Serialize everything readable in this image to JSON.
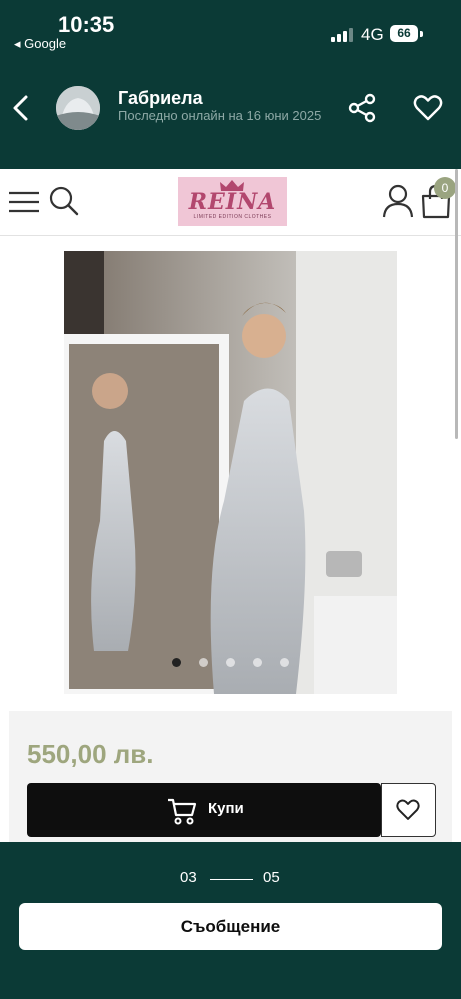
{
  "status_bar": {
    "time": "10:35",
    "back_app": "◂ Google",
    "network": "4G",
    "battery": "66"
  },
  "header": {
    "seller_name": "Габриела",
    "last_seen": "Последно онлайн на 16 юни 2025",
    "icons": [
      "back-arrow-icon",
      "share-icon",
      "heart-icon"
    ]
  },
  "shop": {
    "logo_text": "REINA",
    "logo_tagline": "LIMITED EDITION CLOTHES",
    "cart_count": "0",
    "icons": [
      "hamburger-menu-icon",
      "search-icon",
      "user-icon",
      "shopping-bag-icon"
    ]
  },
  "product": {
    "price": "550,00 лв.",
    "buy_label": "Купи",
    "image_count": 5,
    "active_dot": 0
  },
  "gallery": {
    "current": "03",
    "total": "05"
  },
  "message_button": "Съобщение",
  "colors": {
    "header_bg": "#0b3a36",
    "price": "#9ea67e",
    "logo_bg": "#f0c6d6",
    "logo_text": "#b2476e",
    "buy_bg": "#0e0e0e"
  }
}
